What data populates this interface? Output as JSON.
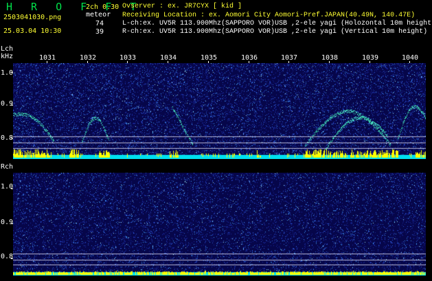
{
  "header": {
    "logo": "H R O F F T",
    "filename": "2503041030.png",
    "datetime": "25.03.04 10:30",
    "channel_info": "2ch 0.30",
    "meteor_label": "meteor",
    "meteor_count_l": "74",
    "meteor_count_r": "39",
    "observer_line": "Ovserver           : ex. JR7CYX [ kid ]",
    "location_line": "Receiving Location : ex. Aomori City Aomori-Pref.JAPAN(40.49N, 140.47E)",
    "lch_line": "L-ch:ex. UV5R 113.900Mhz(SAPPORO VOR)USB ,2-ele yagi (Holozontal 10m height)",
    "rch_line": "R-ch:ex. UV5R 113.900Mhz(SAPPORO VOR)USB ,2-ele yagi (Vertical 10m height)"
  },
  "lch_panel": {
    "label": "Lch",
    "unit": "kHz",
    "time_labels": [
      "1031",
      "1032",
      "1033",
      "1034",
      "1035",
      "1036",
      "1037",
      "1038",
      "1039",
      "1040"
    ],
    "y_labels": [
      "1.0",
      "0.9",
      "0.8"
    ]
  },
  "rch_panel": {
    "label": "Rch",
    "y_labels": [
      "1.0",
      "0.9",
      "0.8"
    ]
  },
  "colors": {
    "background": "#000000",
    "spectrum_base": "#06064a",
    "noise_band": "#00e0f0",
    "burst_yellow": "#ffff00",
    "header_yellow": "#ffff33",
    "logo_green": "#00e04a"
  }
}
